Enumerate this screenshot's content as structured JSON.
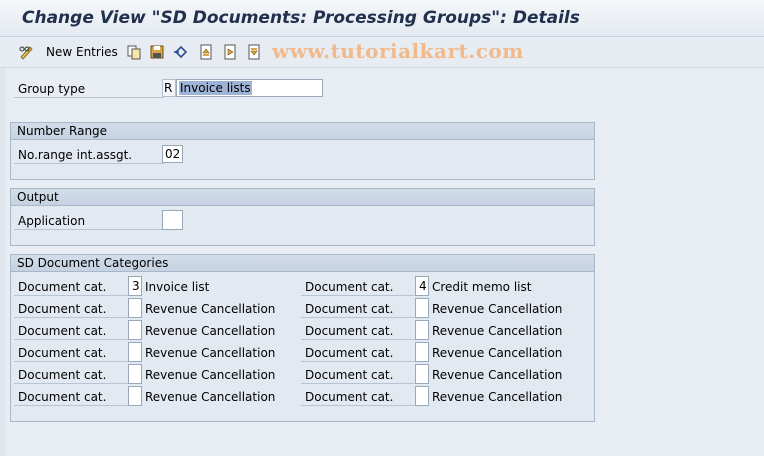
{
  "window": {
    "title": "Change View \"SD Documents: Processing Groups\": Details"
  },
  "toolbar": {
    "new_entries_label": "New Entries",
    "icons": [
      "pencil-glasses-icon",
      "copy-icon",
      "save-icon",
      "undo-icon",
      "first-page-icon",
      "next-page-icon",
      "last-page-icon"
    ]
  },
  "watermark": "www.tutorialkart.com",
  "group_type": {
    "label": "Group type",
    "code": "R",
    "value": "Invoice lists"
  },
  "number_range": {
    "header": "Number Range",
    "label": "No.range int.assgt.",
    "value": "02"
  },
  "output": {
    "header": "Output",
    "label": "Application",
    "value": ""
  },
  "sd_categories": {
    "header": "SD Document Categories",
    "left": [
      {
        "label": "Document cat.",
        "value": "3",
        "desc": "Invoice list"
      },
      {
        "label": "Document cat.",
        "value": "",
        "desc": "Revenue Cancellation"
      },
      {
        "label": "Document cat.",
        "value": "",
        "desc": "Revenue Cancellation"
      },
      {
        "label": "Document cat.",
        "value": "",
        "desc": "Revenue Cancellation"
      },
      {
        "label": "Document cat.",
        "value": "",
        "desc": "Revenue Cancellation"
      },
      {
        "label": "Document cat.",
        "value": "",
        "desc": "Revenue Cancellation"
      }
    ],
    "right": [
      {
        "label": "Document cat.",
        "value": "4",
        "desc": "Credit memo list"
      },
      {
        "label": "Document cat.",
        "value": "",
        "desc": "Revenue Cancellation"
      },
      {
        "label": "Document cat.",
        "value": "",
        "desc": "Revenue Cancellation"
      },
      {
        "label": "Document cat.",
        "value": "",
        "desc": "Revenue Cancellation"
      },
      {
        "label": "Document cat.",
        "value": "",
        "desc": "Revenue Cancellation"
      },
      {
        "label": "Document cat.",
        "value": "",
        "desc": "Revenue Cancellation"
      }
    ]
  },
  "colors": {
    "title": "#21314d",
    "watermark": "#f2b98a",
    "group_header": "#c6d2e1",
    "selection": "#9db4d6"
  }
}
